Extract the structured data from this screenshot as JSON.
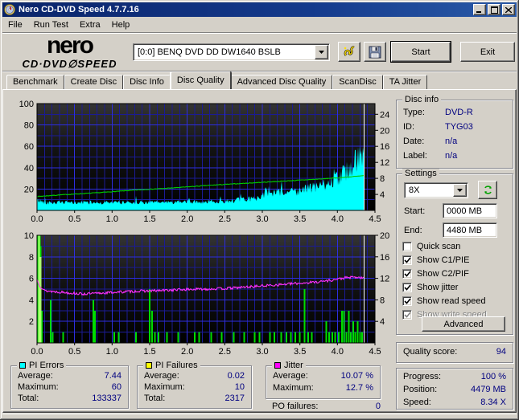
{
  "window": {
    "title": "Nero CD-DVD Speed 4.7.7.16"
  },
  "menu": {
    "items": [
      "File",
      "Run Test",
      "Extra",
      "Help"
    ]
  },
  "header": {
    "logo_top": "nero",
    "logo_bottom": "CD·DVD∅SPEED",
    "drive_select": "[0:0]   BENQ DVD DD DW1640 BSLB",
    "start_label": "Start",
    "exit_label": "Exit"
  },
  "tabs": {
    "active_index": 3,
    "items": [
      {
        "label": "Benchmark"
      },
      {
        "label": "Create Disc"
      },
      {
        "label": "Disc Info"
      },
      {
        "label": "Disc Quality"
      },
      {
        "label": "Advanced Disc Quality"
      },
      {
        "label": "ScanDisc"
      },
      {
        "label": "TA Jitter"
      }
    ]
  },
  "disc_info": {
    "title": "Disc info",
    "rows": [
      {
        "label": "Type:",
        "value": "DVD-R"
      },
      {
        "label": "ID:",
        "value": "TYG03"
      },
      {
        "label": "Date:",
        "value": "n/a"
      },
      {
        "label": "Label:",
        "value": "n/a"
      }
    ]
  },
  "settings": {
    "title": "Settings",
    "speed_value": "8X",
    "start_label": "Start:",
    "start_value": "0000 MB",
    "end_label": "End:",
    "end_value": "4480 MB",
    "advanced_label": "Advanced",
    "checkboxes": [
      {
        "label": "Quick scan",
        "checked": false,
        "enabled": true
      },
      {
        "label": "Show C1/PIE",
        "checked": true,
        "enabled": true
      },
      {
        "label": "Show C2/PIF",
        "checked": true,
        "enabled": true
      },
      {
        "label": "Show jitter",
        "checked": true,
        "enabled": true
      },
      {
        "label": "Show read speed",
        "checked": true,
        "enabled": true
      },
      {
        "label": "Show write speed",
        "checked": true,
        "enabled": false
      }
    ]
  },
  "quality": {
    "label": "Quality score:",
    "value": "94"
  },
  "progress": {
    "rows": [
      {
        "label": "Progress:",
        "value": "100 %"
      },
      {
        "label": "Position:",
        "value": "4479 MB"
      },
      {
        "label": "Speed:",
        "value": "8.34 X"
      }
    ]
  },
  "legend_boxes": [
    {
      "title": "PI Errors",
      "swatch": "#00ffff",
      "rows": [
        {
          "label": "Average:",
          "value": "7.44"
        },
        {
          "label": "Maximum:",
          "value": "60"
        },
        {
          "label": "Total:",
          "value": "133337"
        }
      ]
    },
    {
      "title": "PI Failures",
      "swatch": "#ffff00",
      "rows": [
        {
          "label": "Average:",
          "value": "0.02"
        },
        {
          "label": "Maximum:",
          "value": "10"
        },
        {
          "label": "Total:",
          "value": "2317"
        }
      ]
    },
    {
      "title": "Jitter",
      "swatch": "#ff00ff",
      "rows": [
        {
          "label": "Average:",
          "value": "10.07 %"
        },
        {
          "label": "Maximum:",
          "value": "12.7 %"
        }
      ]
    }
  ],
  "po_failures": {
    "label": "PO failures:",
    "value": "0"
  },
  "chart_data": [
    {
      "type": "area",
      "title": "PI Errors vs position (GB) with read speed overlay",
      "x_axis_gb": true,
      "xmax": 4.5,
      "ymax": 100,
      "rmax": 26.667,
      "y_cap": 62,
      "grid": {
        "minor": [
          0.1,
          10
        ],
        "major": [
          0.5,
          20
        ]
      },
      "x_ticks": [
        [
          0,
          "0.0"
        ],
        [
          0.5,
          "0.5"
        ],
        [
          1,
          "1.0"
        ],
        [
          1.5,
          "1.5"
        ],
        [
          2,
          "2.0"
        ],
        [
          2.5,
          "2.5"
        ],
        [
          3,
          "3.0"
        ],
        [
          3.5,
          "3.5"
        ],
        [
          4,
          "4.0"
        ],
        [
          4.5,
          "4.5"
        ]
      ],
      "left_ticks": [
        [
          100,
          "100"
        ],
        [
          80,
          "80"
        ],
        [
          60,
          "60"
        ],
        [
          40,
          "40"
        ],
        [
          20,
          "20"
        ]
      ],
      "right_ticks": [
        [
          24,
          "24"
        ],
        [
          20,
          "20"
        ],
        [
          16,
          "16"
        ],
        [
          12,
          "12"
        ],
        [
          8,
          "8"
        ],
        [
          4,
          "4"
        ]
      ],
      "series": [
        {
          "name": "pi-errors-area",
          "type": "area",
          "color": "#00ffff",
          "seed": 42,
          "noise": 0.5,
          "spike_p": 0.07,
          "spike_amp": 0.55,
          "end_x": 4.355,
          "points": [
            [
              0,
              9.5
            ],
            [
              0.15,
              7.2
            ],
            [
              0.5,
              7.2
            ],
            [
              1,
              7.4
            ],
            [
              1.5,
              7.6
            ],
            [
              2,
              7.8
            ],
            [
              2.3,
              8.2
            ],
            [
              2.6,
              9.2
            ],
            [
              2.8,
              10.5
            ],
            [
              2.95,
              12
            ],
            [
              3.05,
              15.5
            ],
            [
              3.25,
              16.5
            ],
            [
              3.45,
              18
            ],
            [
              3.6,
              20
            ],
            [
              3.75,
              22
            ],
            [
              3.9,
              26
            ],
            [
              4.0,
              30
            ],
            [
              4.1,
              36
            ],
            [
              4.2,
              43
            ],
            [
              4.3,
              50
            ],
            [
              4.36,
              56
            ]
          ]
        },
        {
          "name": "read-speed-line",
          "type": "line",
          "color": "#00cc00",
          "seed": 7,
          "noise": 0.3,
          "end_x": 4.355,
          "points": [
            [
              0,
              13
            ],
            [
              0.3,
              14.5
            ],
            [
              0.8,
              16.5
            ],
            [
              1.3,
              19
            ],
            [
              1.8,
              21
            ],
            [
              2.3,
              23.5
            ],
            [
              2.8,
              25.5
            ],
            [
              3.3,
              27.5
            ],
            [
              3.8,
              29.5
            ],
            [
              4.1,
              31
            ],
            [
              4.36,
              32.5
            ]
          ]
        },
        {
          "name": "scan-cursor",
          "type": "vline",
          "color": "#ffffff",
          "x": 4.355
        }
      ]
    },
    {
      "type": "bar",
      "title": "PI Failures vs position (GB) with jitter overlay",
      "xmax": 4.5,
      "ymax": 10,
      "rmax": 20,
      "grid": {
        "minor": [
          0.1,
          1
        ],
        "major": [
          0.5,
          2
        ]
      },
      "x_ticks": [
        [
          0,
          "0.0"
        ],
        [
          0.5,
          "0.5"
        ],
        [
          1,
          "1.0"
        ],
        [
          1.5,
          "1.5"
        ],
        [
          2,
          "2.0"
        ],
        [
          2.5,
          "2.5"
        ],
        [
          3,
          "3.0"
        ],
        [
          3.5,
          "3.5"
        ],
        [
          4,
          "4.0"
        ],
        [
          4.5,
          "4.5"
        ]
      ],
      "left_ticks": [
        [
          10,
          "10"
        ],
        [
          8,
          "8"
        ],
        [
          6,
          "6"
        ],
        [
          4,
          "4"
        ],
        [
          2,
          "2"
        ]
      ],
      "right_ticks": [
        [
          20,
          "20"
        ],
        [
          16,
          "16"
        ],
        [
          12,
          "12"
        ],
        [
          8,
          "8"
        ],
        [
          4,
          "4"
        ]
      ],
      "series": [
        {
          "name": "pi-failures-bars",
          "type": "bars",
          "color": "#00dd00",
          "width": 2,
          "data": [
            [
              0.005,
              10
            ],
            [
              0.02,
              10
            ],
            [
              0.035,
              10
            ],
            [
              0.05,
              9
            ],
            [
              0.065,
              3
            ],
            [
              0.18,
              4
            ],
            [
              0.21,
              1
            ],
            [
              0.35,
              1
            ],
            [
              0.75,
              4
            ],
            [
              0.77,
              3
            ],
            [
              1.03,
              1
            ],
            [
              1.09,
              1
            ],
            [
              1.32,
              1
            ],
            [
              1.5,
              5
            ],
            [
              1.53,
              3
            ],
            [
              1.57,
              1
            ],
            [
              1.62,
              1
            ],
            [
              1.73,
              1
            ],
            [
              1.88,
              1
            ],
            [
              2.1,
              1
            ],
            [
              2.16,
              1
            ],
            [
              2.32,
              1
            ],
            [
              2.46,
              1
            ],
            [
              2.62,
              1
            ],
            [
              2.76,
              1
            ],
            [
              2.9,
              1
            ],
            [
              2.96,
              1
            ],
            [
              3.1,
              1
            ],
            [
              3.16,
              1
            ],
            [
              3.25,
              1
            ],
            [
              3.32,
              1
            ],
            [
              3.38,
              1
            ],
            [
              3.44,
              1
            ],
            [
              3.5,
              1
            ],
            [
              3.56,
              5
            ],
            [
              3.61,
              1
            ],
            [
              3.66,
              1
            ],
            [
              3.85,
              2
            ],
            [
              3.89,
              1
            ],
            [
              3.93,
              1
            ],
            [
              3.97,
              1
            ],
            [
              4.02,
              1
            ],
            [
              4.06,
              3
            ],
            [
              4.09,
              3
            ],
            [
              4.12,
              1
            ],
            [
              4.15,
              3
            ],
            [
              4.18,
              1
            ],
            [
              4.21,
              2
            ],
            [
              4.24,
              1
            ],
            [
              4.27,
              2
            ],
            [
              4.3,
              1
            ],
            [
              4.33,
              1
            ]
          ]
        },
        {
          "name": "pi-failures-bars-bright",
          "type": "bars",
          "color": "#aaff70",
          "width": 2,
          "data": [
            [
              0.025,
              10
            ],
            [
              0.05,
              8
            ]
          ]
        },
        {
          "name": "jitter-line",
          "type": "line",
          "color": "#ff30ff",
          "seed": 13,
          "noise": 0.12,
          "end_x": 4.355,
          "points": [
            [
              0,
              5.9
            ],
            [
              0.04,
              5.3
            ],
            [
              0.1,
              4.85
            ],
            [
              0.35,
              4.7
            ],
            [
              0.6,
              4.55
            ],
            [
              0.8,
              4.6
            ],
            [
              1.0,
              4.7
            ],
            [
              1.3,
              4.8
            ],
            [
              1.6,
              4.85
            ],
            [
              1.9,
              4.95
            ],
            [
              2.2,
              5.0
            ],
            [
              2.5,
              5.05
            ],
            [
              2.8,
              5.2
            ],
            [
              3.1,
              5.35
            ],
            [
              3.4,
              5.5
            ],
            [
              3.7,
              5.65
            ],
            [
              3.95,
              5.85
            ],
            [
              4.1,
              6.05
            ],
            [
              4.25,
              6.1
            ],
            [
              4.36,
              6.0
            ]
          ]
        },
        {
          "name": "scan-cursor",
          "type": "vline",
          "color": "#ffffff",
          "x": 4.355
        }
      ]
    }
  ]
}
